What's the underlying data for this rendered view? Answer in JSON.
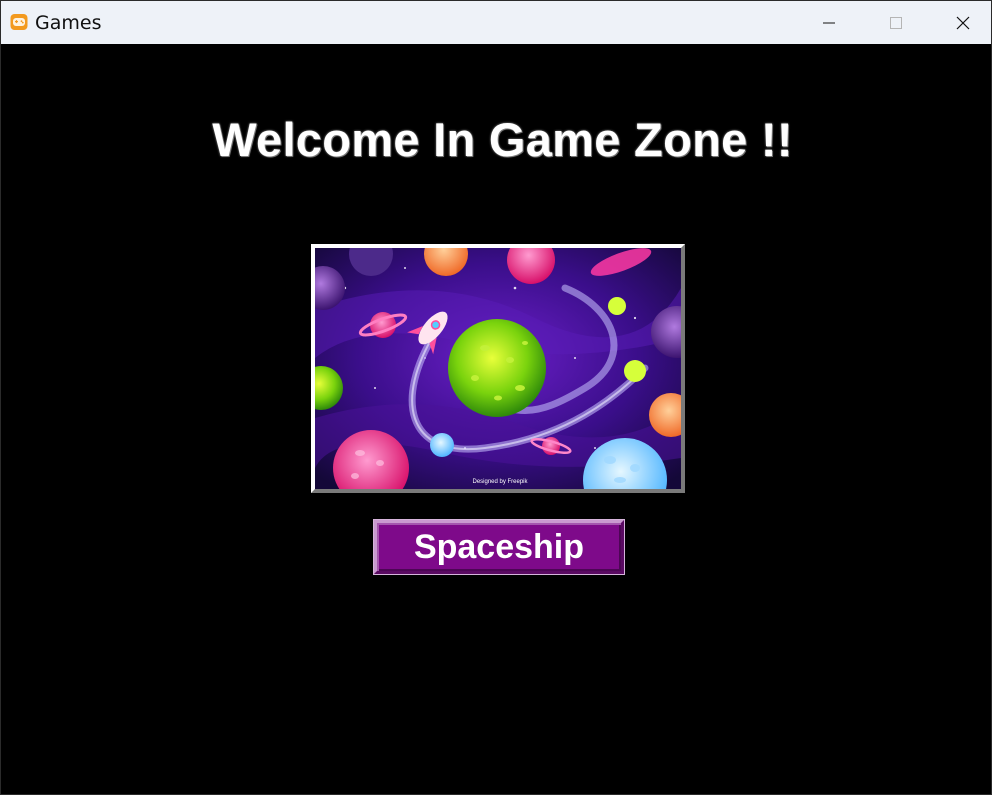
{
  "window": {
    "title": "Games",
    "app_icon": "gamepad-icon",
    "controls": [
      "minimize-icon",
      "maximize-icon",
      "close-icon"
    ]
  },
  "main": {
    "heading": "Welcome In Game Zone !!",
    "game_image": {
      "caption": "Designed by Freepik"
    },
    "game_button_label": "Spaceship"
  },
  "colors": {
    "titlebar_bg": "#eef2f8",
    "content_bg": "#000000",
    "button_bg": "#7e0a8a",
    "heading_text": "#ffffff"
  }
}
